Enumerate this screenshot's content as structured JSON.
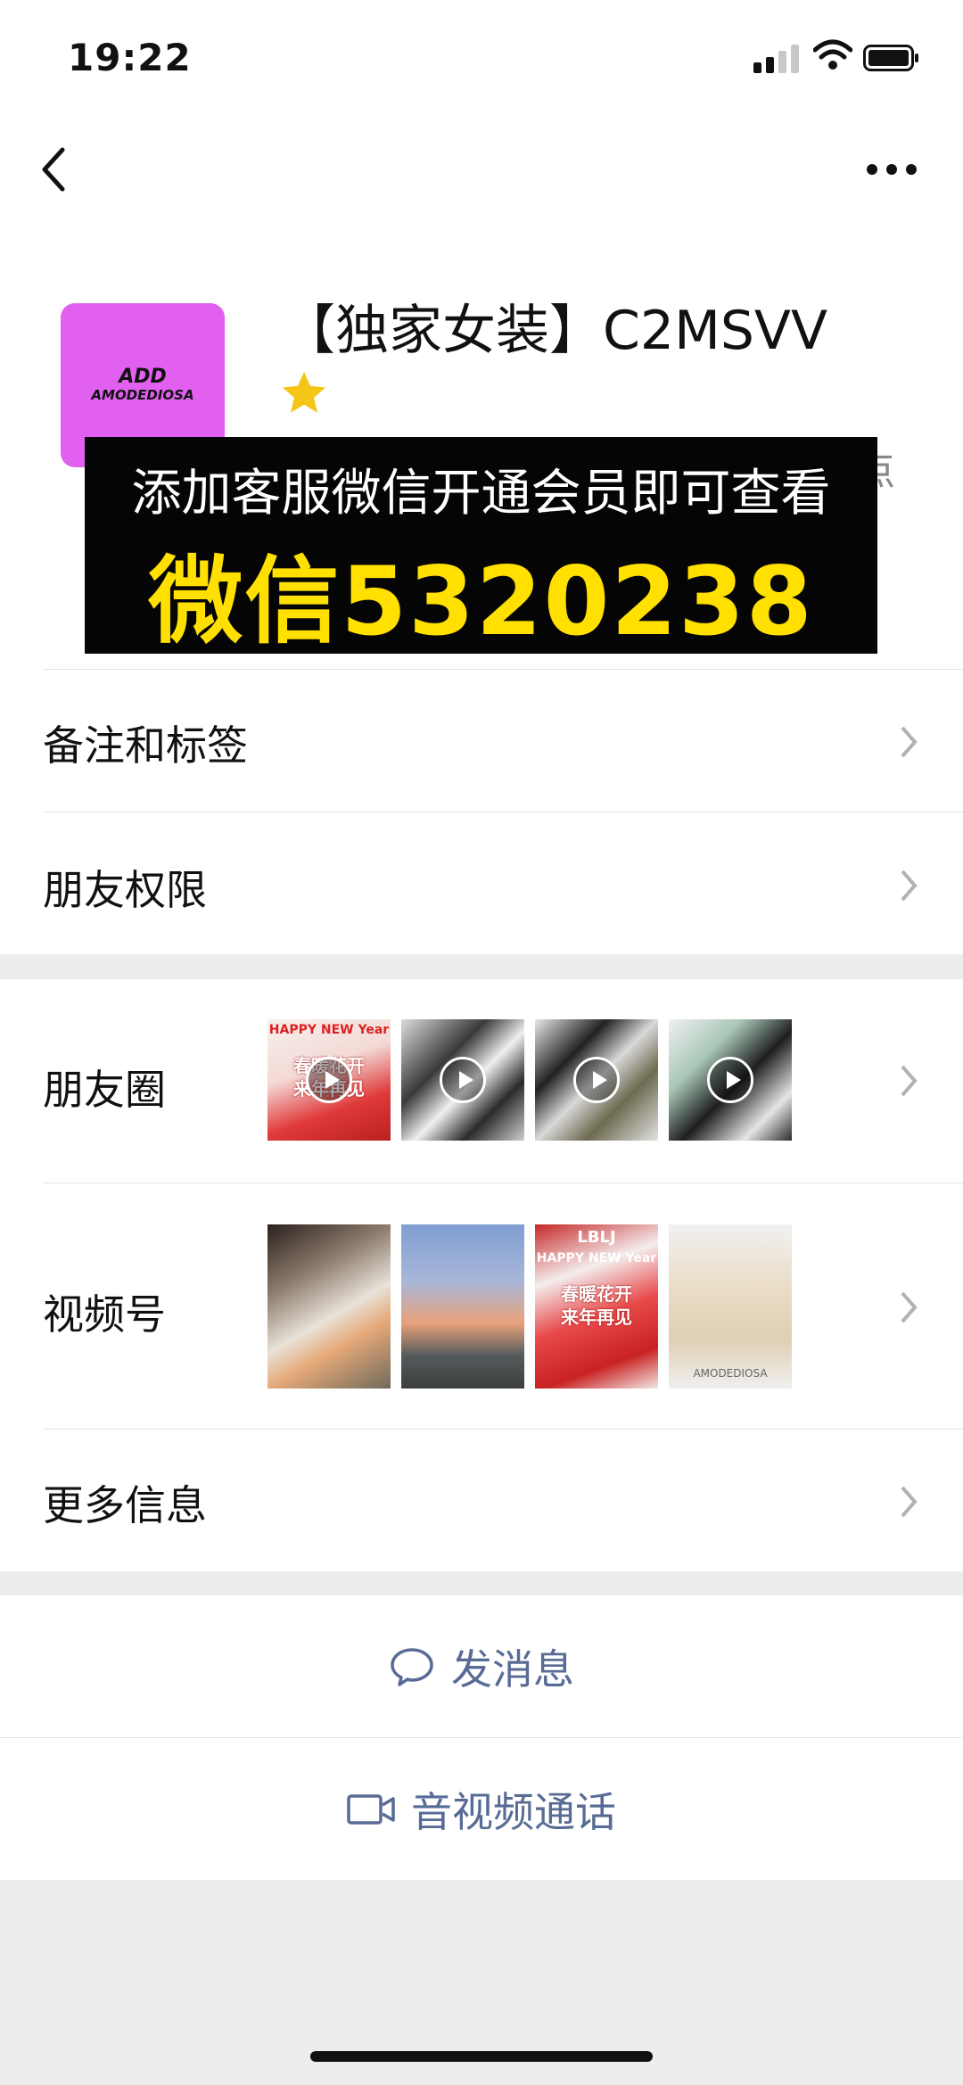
{
  "status_bar": {
    "time": "19:22"
  },
  "profile": {
    "name": "【独家女装】C2MSVV",
    "avatar_line1": "ADD",
    "avatar_line2": "AMODEDIOSA",
    "partial_text": "点"
  },
  "banner": {
    "line1": "添加客服微信开通会员即可查看",
    "line2": "微信5320238"
  },
  "rows": {
    "remarks": "备注和标签",
    "permissions": "朋友权限",
    "moments": "朋友圈",
    "channels": "视频号",
    "more_info": "更多信息"
  },
  "thumb_text": {
    "happy_new": "HAPPY NEW Year",
    "caption_a": "春暖花开",
    "caption_b": "来年再见",
    "lbl_top": "LBLJ",
    "watermark": "AMODEDIOSA"
  },
  "actions": {
    "message": "发消息",
    "call": "音视频通话"
  },
  "colors": {
    "accent_link": "#576b95",
    "banner_yellow": "#ffe000",
    "avatar_bg": "#e160f0",
    "star": "#f5c518"
  }
}
